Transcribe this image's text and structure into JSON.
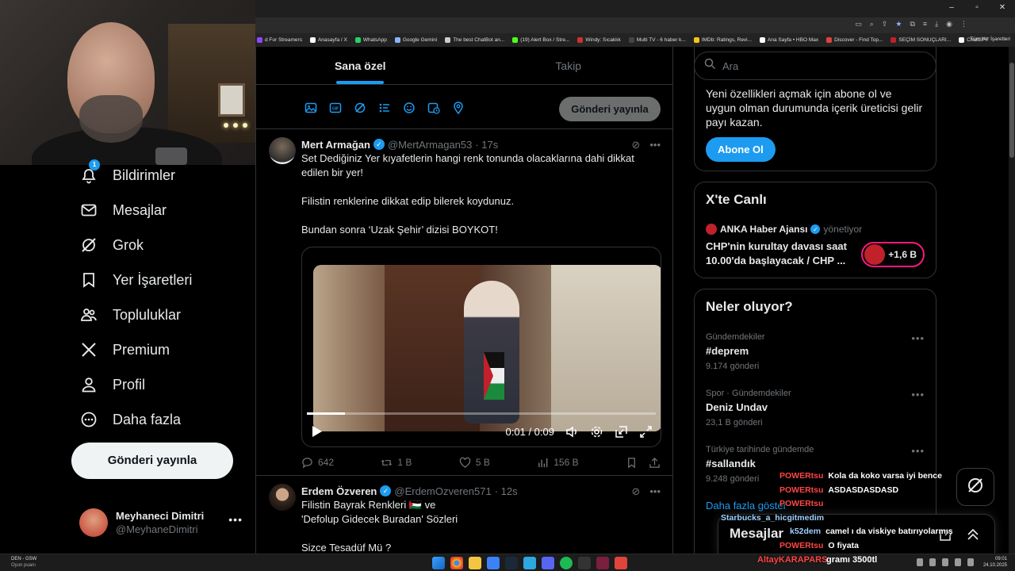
{
  "browser": {
    "bookmarks": [
      {
        "label": "d For Streamers",
        "color": "#9146ff"
      },
      {
        "label": "Anasayfa / X",
        "color": "#ffffff"
      },
      {
        "label": "WhatsApp",
        "color": "#25d366"
      },
      {
        "label": "Google Gemini",
        "color": "#8ab4f8"
      },
      {
        "label": "The best ChatBot an...",
        "color": "#cccccc"
      },
      {
        "label": "(19) Alert Box / Stre...",
        "color": "#53fc18"
      },
      {
        "label": "Windy: Sıcaklık",
        "color": "#d03030"
      },
      {
        "label": "Multi TV - 6 haber k...",
        "color": "#444444"
      },
      {
        "label": "IMDb: Ratings, Revi...",
        "color": "#f5c518"
      },
      {
        "label": "Ana Sayfa • HBO Max",
        "color": "#ffffff"
      },
      {
        "label": "Discover - Find Top...",
        "color": "#e04040"
      },
      {
        "label": "SEÇİM SONUÇLARI...",
        "color": "#c0212b"
      },
      {
        "label": "ChatGPT",
        "color": "#ffffff"
      }
    ],
    "all_bookmarks": "Tüm Yer İşaretleri"
  },
  "nav": {
    "notif_count": "1",
    "items": [
      {
        "label": "Bildirimler",
        "icon": "bell-icon"
      },
      {
        "label": "Mesajlar",
        "icon": "mail-icon"
      },
      {
        "label": "Grok",
        "icon": "grok-icon"
      },
      {
        "label": "Yer İşaretleri",
        "icon": "bookmark-icon"
      },
      {
        "label": "Topluluklar",
        "icon": "communities-icon"
      },
      {
        "label": "Premium",
        "icon": "x-logo-icon"
      },
      {
        "label": "Profil",
        "icon": "profile-icon"
      },
      {
        "label": "Daha fazla",
        "icon": "more-circle-icon"
      }
    ],
    "post_button": "Gönderi yayınla",
    "account_name": "Meyhaneci Dimitri",
    "account_handle": "@MeyhaneDimitri"
  },
  "main": {
    "tabs": [
      "Sana özel",
      "Takip"
    ],
    "post_button": "Gönderi yayınla",
    "tweets": [
      {
        "name": "Mert Armağan",
        "handle": "@MertArmagan53",
        "time": "· 17s",
        "text": "Set Dediğiniz Yer kıyafetlerin  hangi renk tonunda olacaklarına dahi dikkat edilen bir yer!\n\nFilistin renklerine dikkat edip bilerek koydunuz.\n\nBundan sonra ‘Uzak Şehir’ dizisi BOYKOT!",
        "video_time": "0:01 / 0:09",
        "video_progress": 0.11,
        "replies": "642",
        "reposts": "1 B",
        "likes": "5 B",
        "views": "156 B"
      },
      {
        "name": "Erdem Özveren",
        "handle": "@ErdemOzveren571",
        "time": "· 12s",
        "text": "Filistin Bayrak Renkleri 🇵🇸 ve\n'Defolup Gidecek Buradan' Sözleri\n\nSizce Tesadüf Mü ?"
      }
    ]
  },
  "right": {
    "search_placeholder": "Ara",
    "premium_text": "Yeni özellikleri açmak için abone ol ve uygun olman durumunda içerik üreticisi gelir payı kazan.",
    "subscribe_button": "Abone Ol",
    "live_title": "X'te Canlı",
    "live_host": "ANKA Haber Ajansı",
    "live_role": "yönetiyor",
    "live_text": "CHP'nin kurultay davası saat 10.00'da başlayacak / CHP ...",
    "live_count": "+1,6 B",
    "trends_title": "Neler oluyor?",
    "trends": [
      {
        "meta": "Gündemdekiler",
        "topic": "#deprem",
        "count": "9.174 gönderi"
      },
      {
        "meta": "Spor · Gündemdekiler",
        "topic": "Deniz Undav",
        "count": "23,1 B gönderi"
      },
      {
        "meta": "Türkiye tarihinde gündemde",
        "topic": "#sallandık",
        "count": "9.248 gönderi"
      }
    ],
    "show_more": "Daha fazla göster"
  },
  "messages_drawer": {
    "title": "Mesajlar"
  },
  "chat": [
    {
      "user": "POWERtsu",
      "msg": "Kola da koko varsa iyi bence",
      "alt": false
    },
    {
      "user": "POWERtsu",
      "msg": "ASDASDASDASD",
      "alt": false
    },
    {
      "user": "POWERtsu",
      "msg": "",
      "alt": false
    },
    {
      "user": "Starbucks_a_hicgitmedim",
      "msg": "",
      "alt": true
    },
    {
      "user": "k52dem",
      "msg": "camel ı da viskiye batırıyolarmış",
      "alt": true
    },
    {
      "user": "POWERtsu",
      "msg": "O fiyata",
      "alt": false
    }
  ],
  "overlay": {
    "user": "AltayKARAPARS",
    "msg": "gramı 3500tl"
  },
  "taskbar": {
    "weather_line1": "DEN - GSW",
    "weather_line2": "Oyun puanı",
    "time": "09:01",
    "date": "24.10.2025"
  }
}
